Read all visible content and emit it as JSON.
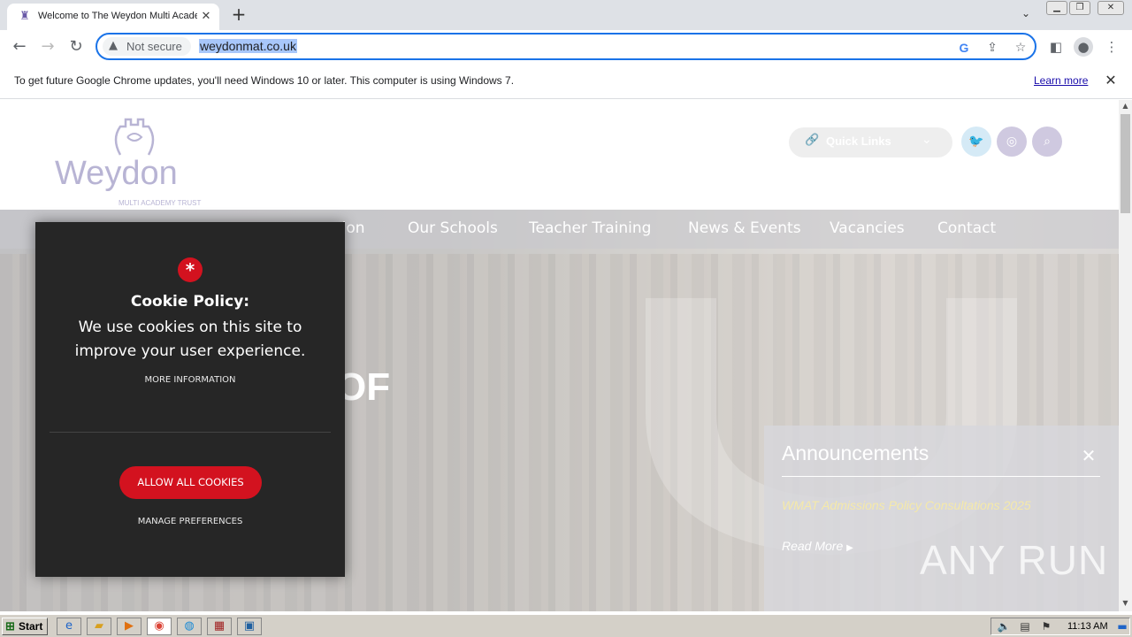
{
  "browser": {
    "tab": {
      "title": "Welcome to The Weydon Multi Academ",
      "favicon": "weydon-crest-icon"
    },
    "omnibox": {
      "security_label": "Not secure",
      "url": "weydonmat.co.uk"
    },
    "infobar": {
      "message": "To get future Google Chrome updates, you'll need Windows 10 or later. This computer is using Windows 7.",
      "link": "Learn more"
    }
  },
  "site": {
    "logo": {
      "word": "Weydon",
      "subtitle": "MULTI ACADEMY TRUST"
    },
    "quick_links": "Quick Links",
    "nav": [
      "tion",
      "Our Schools",
      "Teacher Training",
      "News & Events",
      "Vacancies",
      "Contact"
    ],
    "hero_fragment": "OF",
    "announcements": {
      "title": "Announcements",
      "item": "WMAT Admissions Policy Consultations 2025",
      "read_more": "Read More"
    },
    "colors": {
      "brand_purple": "#b8b4d4",
      "cookie_red": "#d3121f",
      "twitter": "#5fb8e8"
    }
  },
  "cookie": {
    "title": "Cookie Policy:",
    "message": "We use cookies on this site to improve your user experience.",
    "more_info": "MORE INFORMATION",
    "allow": "ALLOW ALL COOKIES",
    "manage": "MANAGE PREFERENCES"
  },
  "watermark": "ANY RUN",
  "taskbar": {
    "start": "Start",
    "clock": "11:13 AM"
  }
}
